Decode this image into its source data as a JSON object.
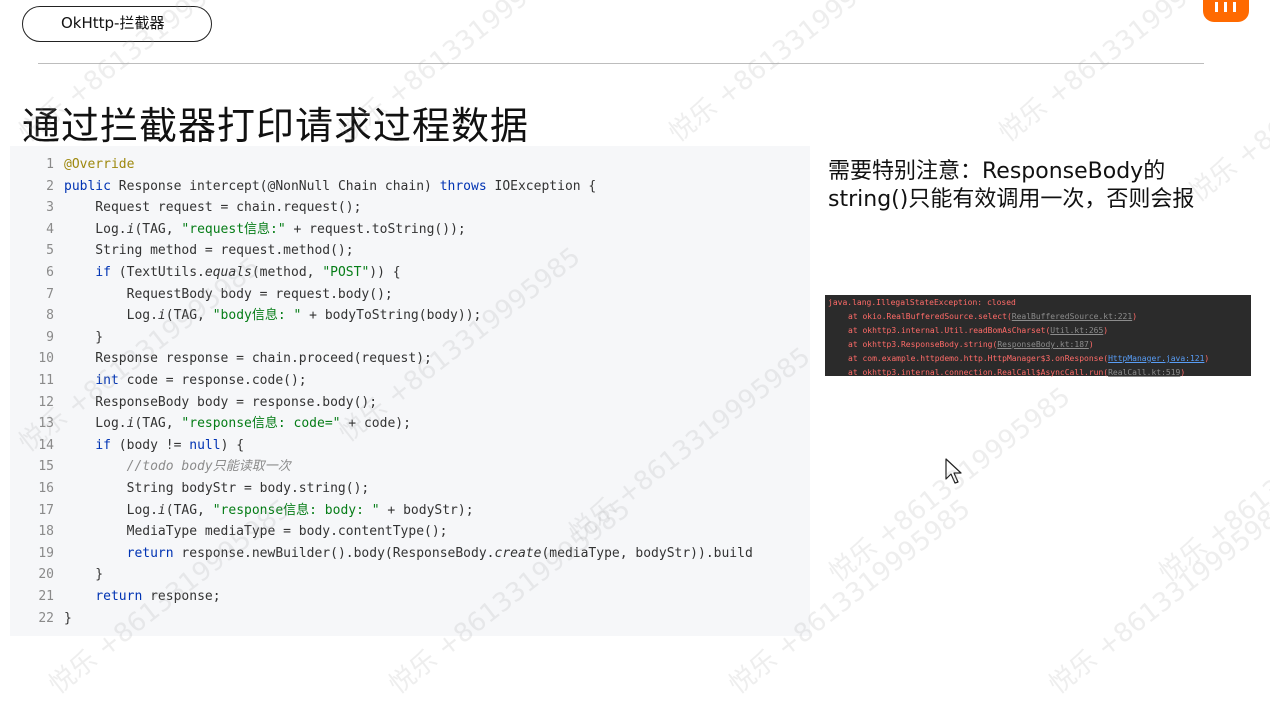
{
  "header": {
    "tag_label": "OkHttp-拦截器"
  },
  "slide": {
    "title": "通过拦截器打印请求过程数据",
    "note": "需要特别注意：ResponseBody的string()只能有效调用一次，否则会报"
  },
  "code": {
    "lines": [
      {
        "n": "1",
        "t": "@Override"
      },
      {
        "n": "2",
        "t": "public Response intercept(@NonNull Chain chain) throws IOException {"
      },
      {
        "n": "3",
        "t": "    Request request = chain.request();"
      },
      {
        "n": "4",
        "t": "    Log.i(TAG, \"request信息:\" + request.toString());"
      },
      {
        "n": "5",
        "t": "    String method = request.method();"
      },
      {
        "n": "6",
        "t": "    if (TextUtils.equals(method, \"POST\")) {"
      },
      {
        "n": "7",
        "t": "        RequestBody body = request.body();"
      },
      {
        "n": "8",
        "t": "        Log.i(TAG, \"body信息: \" + bodyToString(body));"
      },
      {
        "n": "9",
        "t": "    }"
      },
      {
        "n": "10",
        "t": "    Response response = chain.proceed(request);"
      },
      {
        "n": "11",
        "t": "    int code = response.code();"
      },
      {
        "n": "12",
        "t": "    ResponseBody body = response.body();"
      },
      {
        "n": "13",
        "t": "    Log.i(TAG, \"response信息: code=\" + code);"
      },
      {
        "n": "14",
        "t": "    if (body != null) {"
      },
      {
        "n": "15",
        "t": "        //todo body只能读取一次"
      },
      {
        "n": "16",
        "t": "        String bodyStr = body.string();"
      },
      {
        "n": "17",
        "t": "        Log.i(TAG, \"response信息: body: \" + bodyStr);"
      },
      {
        "n": "18",
        "t": "        MediaType mediaType = body.contentType();"
      },
      {
        "n": "19",
        "t": "        return response.newBuilder().body(ResponseBody.create(mediaType, bodyStr)).build"
      },
      {
        "n": "20",
        "t": "    }"
      },
      {
        "n": "21",
        "t": "    return response;"
      },
      {
        "n": "22",
        "t": "}"
      }
    ]
  },
  "console": {
    "exception": "java.lang.IllegalStateException: closed",
    "frames": [
      {
        "at": "at okio.RealBufferedSource.select(",
        "link": "RealBufferedSource.kt:221",
        "end": ")",
        "highlight": false
      },
      {
        "at": "at okhttp3.internal.Util.readBomAsCharset(",
        "link": "Util.kt:265",
        "end": ")",
        "highlight": false
      },
      {
        "at": "at okhttp3.ResponseBody.string(",
        "link": "ResponseBody.kt:187",
        "end": ")",
        "highlight": false
      },
      {
        "at": "at com.example.httpdemo.http.HttpManager$3.onResponse(",
        "link": "HttpManager.java:121",
        "end": ")",
        "highlight": true
      },
      {
        "at": "at okhttp3.internal.connection.RealCall$AsyncCall.run(",
        "link": "RealCall.kt:519",
        "end": ")",
        "highlight": false
      }
    ]
  },
  "watermark": {
    "text": "悦乐 +8613319995985"
  },
  "colors": {
    "accent": "#ff6a00",
    "code_bg": "#f6f7f9",
    "console_bg": "#2b2b2b",
    "keyword": "#0033b3",
    "string": "#067d17",
    "type": "#c7501f",
    "error": "#ff6b68"
  },
  "icons": {
    "logo": "brand-logo-icon",
    "cursor": "mouse-pointer-icon"
  }
}
